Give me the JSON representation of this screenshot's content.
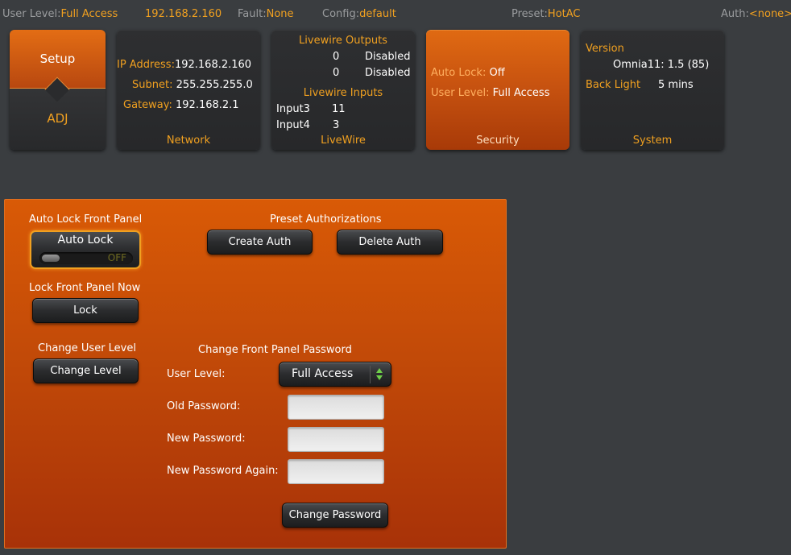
{
  "status": {
    "user_level_label": "User Level:",
    "user_level_value": "Full Access",
    "ip": "192.168.2.160",
    "fault_label": "Fault:",
    "fault_value": "None",
    "config_label": "Config:",
    "config_value": "default",
    "preset_label": "Preset:",
    "preset_value": "HotAC",
    "auth_label": "Auth:",
    "auth_value": "<none>"
  },
  "tiles": {
    "setup": {
      "top_label": "Setup",
      "bottom_label": "ADJ"
    },
    "network": {
      "title": "Network",
      "ip_label": "IP Address:",
      "ip_value": "192.168.2.160",
      "subnet_label": "Subnet:",
      "subnet_value": "255.255.255.0",
      "gateway_label": "Gateway:",
      "gateway_value": "192.168.2.1"
    },
    "livewire": {
      "title": "LiveWire",
      "outputs_heading": "Livewire Outputs",
      "outputs": [
        {
          "channel": "0",
          "state": "Disabled"
        },
        {
          "channel": "0",
          "state": "Disabled"
        }
      ],
      "inputs_heading": "Livewire Inputs",
      "inputs": [
        {
          "name": "Input3",
          "channel": "11"
        },
        {
          "name": "Input4",
          "channel": "3"
        }
      ]
    },
    "security": {
      "title": "Security",
      "auto_lock_label": "Auto Lock:",
      "auto_lock_value": "Off",
      "user_level_label": "User Level:",
      "user_level_value": "Full Access"
    },
    "system": {
      "title": "System",
      "version_label": "Version",
      "version_value": "Omnia11: 1.5 (85)",
      "backlight_label": "Back Light",
      "backlight_value": "5 mins"
    }
  },
  "panel": {
    "auto_lock_heading": "Auto Lock Front Panel",
    "auto_lock_toggle_title": "Auto Lock",
    "auto_lock_toggle_state": "OFF",
    "lock_now_heading": "Lock Front Panel Now",
    "lock_button": "Lock",
    "change_user_heading": "Change User Level",
    "change_level_button": "Change Level",
    "preset_auth_heading": "Preset Authorizations",
    "create_auth_button": "Create Auth",
    "delete_auth_button": "Delete Auth",
    "change_pw_heading": "Change Front Panel Password",
    "user_level_label": "User Level:",
    "user_level_select": "Full Access",
    "old_pw_label": "Old Password:",
    "new_pw_label": "New Password:",
    "new_pw_again_label": "New Password Again:",
    "old_pw_value": "",
    "new_pw_value": "",
    "new_pw_again_value": "",
    "change_pw_button": "Change Password"
  },
  "colors": {
    "accent": "#f0a020",
    "panel_orange": "#c94e08",
    "background": "#3a3d40",
    "toggle_led": "#6fd04a"
  }
}
